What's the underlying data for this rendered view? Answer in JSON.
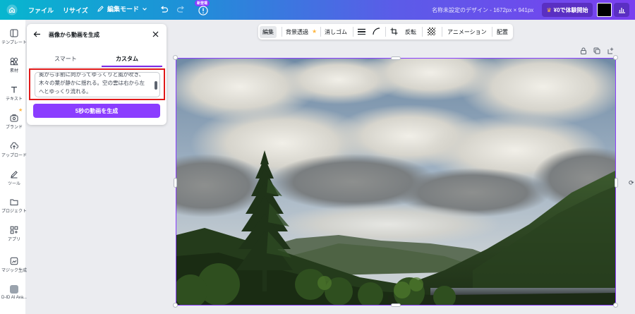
{
  "topbar": {
    "file": "ファイル",
    "resize": "リサイズ",
    "mode": "編集モード",
    "new_badge": "新登場",
    "doc_title": "名称未設定のデザイン - 1672px × 941px",
    "trial": "¥0で体験開始"
  },
  "rail": {
    "items": [
      {
        "label": "テンプレート",
        "icon": "layout-icon"
      },
      {
        "label": "素材",
        "icon": "elements-icon"
      },
      {
        "label": "テキスト",
        "icon": "text-icon"
      },
      {
        "label": "ブランド",
        "icon": "brand-icon"
      },
      {
        "label": "アップロード",
        "icon": "upload-icon"
      },
      {
        "label": "ツール",
        "icon": "pen-icon"
      },
      {
        "label": "プロジェクト",
        "icon": "folder-icon"
      },
      {
        "label": "アプリ",
        "icon": "apps-icon"
      },
      {
        "label": "マジック生成",
        "icon": "magic-icon"
      },
      {
        "label": "D-ID AI Ava...",
        "icon": "avatar-icon"
      }
    ]
  },
  "panel": {
    "title": "画像から動画を生成",
    "tabs": {
      "smart": "スマート",
      "custom": "カスタム"
    },
    "prompt_lines": [
      "奥から手前に向かってゆっくりと風が吹き、",
      "木々の葉が静かに揺れる。空の雲は右から左",
      "へとゆっくり流れる。"
    ],
    "generate": "5秒の動画を生成"
  },
  "edit_toolbar": {
    "edit": "編集",
    "bg_remove": "背景透過",
    "erase": "消しゴム",
    "flip": "反転",
    "animation": "アニメーション",
    "position": "配置"
  },
  "colors": {
    "accent": "#8b3dff",
    "highlight": "#e01919",
    "premium": "#ffb640"
  }
}
